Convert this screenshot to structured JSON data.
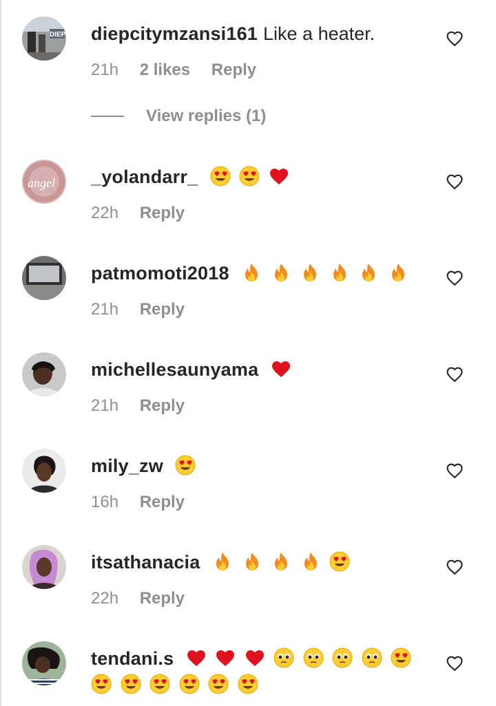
{
  "comments": [
    {
      "username": "diepcitymzansi161",
      "text": "Like a heater.",
      "time": "21h",
      "likes": "2 likes",
      "reply": "Reply",
      "view_replies": "View replies (1)",
      "emojis": []
    },
    {
      "username": "_yolandarr_",
      "text": "",
      "time": "22h",
      "reply": "Reply",
      "emojis": [
        "heart-eyes",
        "heart-eyes",
        "red-heart"
      ]
    },
    {
      "username": "patmomoti2018",
      "text": "",
      "time": "21h",
      "reply": "Reply",
      "emojis": [
        "fire",
        "fire",
        "fire",
        "fire",
        "fire",
        "fire"
      ]
    },
    {
      "username": "michellesaunyama",
      "text": "",
      "time": "21h",
      "reply": "Reply",
      "emojis": [
        "red-heart"
      ]
    },
    {
      "username": "mily_zw",
      "text": "",
      "time": "16h",
      "reply": "Reply",
      "emojis": [
        "heart-eyes"
      ]
    },
    {
      "username": "itsathanacia",
      "text": "",
      "time": "22h",
      "reply": "Reply",
      "emojis": [
        "fire",
        "fire",
        "fire",
        "fire",
        "heart-eyes"
      ]
    },
    {
      "username": "tendani.s",
      "text": "",
      "emojis": [
        "red-heart",
        "red-heart",
        "red-heart",
        "pleading",
        "pleading",
        "pleading",
        "pleading",
        "heart-eyes",
        "heart-eyes",
        "heart-eyes",
        "heart-eyes",
        "heart-eyes",
        "heart-eyes",
        "heart-eyes"
      ]
    }
  ],
  "avatar_1_text": "DIEP",
  "avatar_2_text": "angel",
  "colors": {
    "username": "#262626",
    "meta": "#8e8e8e",
    "heart_red": "#e0121f",
    "emoji_yellow": "#ffcc32",
    "fire_orange": "#f58a1f"
  }
}
